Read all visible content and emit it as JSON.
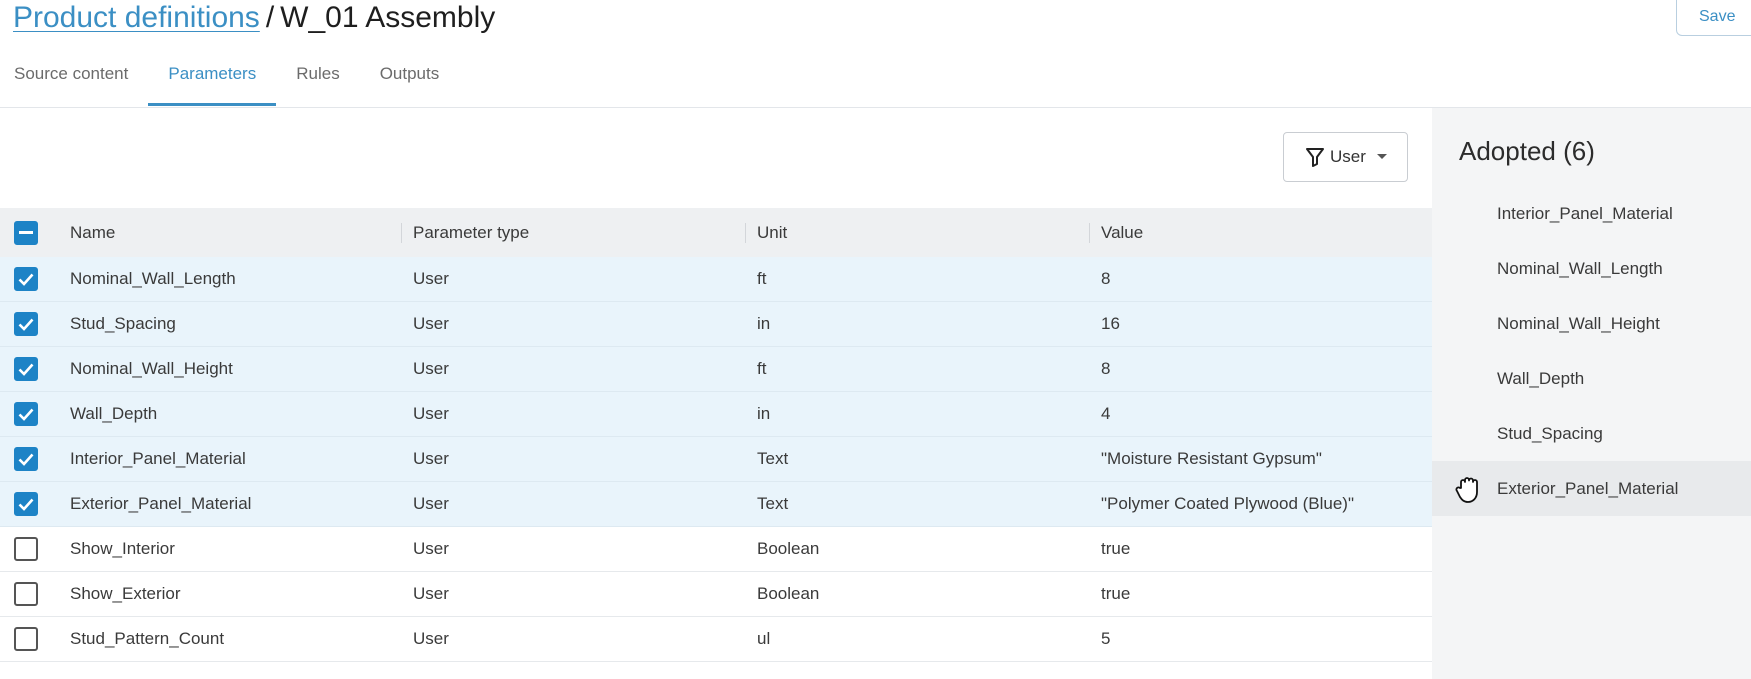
{
  "header": {
    "breadcrumb_link": "Product definitions",
    "breadcrumb_sep": "/",
    "breadcrumb_current": "W_01 Assembly",
    "save_label": "Save"
  },
  "tabs": [
    {
      "label": "Source content",
      "active": false
    },
    {
      "label": "Parameters",
      "active": true
    },
    {
      "label": "Rules",
      "active": false
    },
    {
      "label": "Outputs",
      "active": false
    }
  ],
  "filter": {
    "label": "User",
    "icon": "filter-icon"
  },
  "table": {
    "headers": {
      "name": "Name",
      "type": "Parameter type",
      "unit": "Unit",
      "value": "Value"
    },
    "rows": [
      {
        "name": "Nominal_Wall_Length",
        "type": "User",
        "unit": "ft",
        "value": "8",
        "checked": true
      },
      {
        "name": "Stud_Spacing",
        "type": "User",
        "unit": "in",
        "value": "16",
        "checked": true
      },
      {
        "name": "Nominal_Wall_Height",
        "type": "User",
        "unit": "ft",
        "value": "8",
        "checked": true
      },
      {
        "name": "Wall_Depth",
        "type": "User",
        "unit": "in",
        "value": "4",
        "checked": true
      },
      {
        "name": "Interior_Panel_Material",
        "type": "User",
        "unit": "Text",
        "value": "\"Moisture Resistant Gypsum\"",
        "checked": true
      },
      {
        "name": "Exterior_Panel_Material",
        "type": "User",
        "unit": "Text",
        "value": "\"Polymer Coated Plywood (Blue)\"",
        "checked": true
      },
      {
        "name": "Show_Interior",
        "type": "User",
        "unit": "Boolean",
        "value": "true",
        "checked": false
      },
      {
        "name": "Show_Exterior",
        "type": "User",
        "unit": "Boolean",
        "value": "true",
        "checked": false
      },
      {
        "name": "Stud_Pattern_Count",
        "type": "User",
        "unit": "ul",
        "value": "5",
        "checked": false
      }
    ]
  },
  "adopted": {
    "title": "Adopted (6)",
    "items": [
      {
        "label": "Interior_Panel_Material",
        "hover": false
      },
      {
        "label": "Nominal_Wall_Length",
        "hover": false
      },
      {
        "label": "Nominal_Wall_Height",
        "hover": false
      },
      {
        "label": "Wall_Depth",
        "hover": false
      },
      {
        "label": "Stud_Spacing",
        "hover": false
      },
      {
        "label": "Exterior_Panel_Material",
        "hover": true
      }
    ]
  },
  "colors": {
    "accent": "#3b8fc4",
    "checkbox": "#1d83c6",
    "selected_row": "#e9f4fb"
  }
}
